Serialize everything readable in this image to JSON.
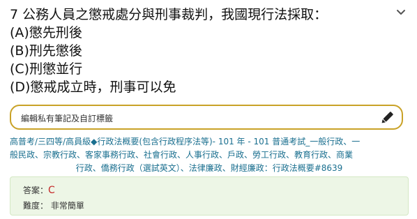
{
  "question": {
    "stem": "7 公務人員之懲戒處分與刑事裁判，我國現行法採取：",
    "options": [
      "(A)懲先刑後",
      "(B)刑先懲後",
      "(C)刑懲並行",
      "(D)懲戒成立時，刑事可以免"
    ],
    "collapse_icon": "chevron-down-icon"
  },
  "notes": {
    "placeholder": "編輯私有筆記及自訂標籤",
    "edit_icon": "pencil-icon",
    "border_color": "#c9a227"
  },
  "tags": {
    "lines": [
      "高普考/三四等/高員級◆行政法概要(包含行政程序法等)- 101 年 - 101 普通考試_一般行政、一",
      "般民政、宗教行政、客家事務行政、社會行政、人事行政、戶政、勞工行政、教育行政、商業",
      "行政、僑務行政（選試英文）、法律廉政、財經廉政：行政法概要#8639"
    ],
    "color": "#1a6f8f"
  },
  "answer": {
    "answer_label": "答案：",
    "answer_value": "C",
    "difficulty_label": "難度：",
    "difficulty_value": "非常簡單",
    "background": "#edf6e6",
    "answer_color": "#c62828"
  }
}
